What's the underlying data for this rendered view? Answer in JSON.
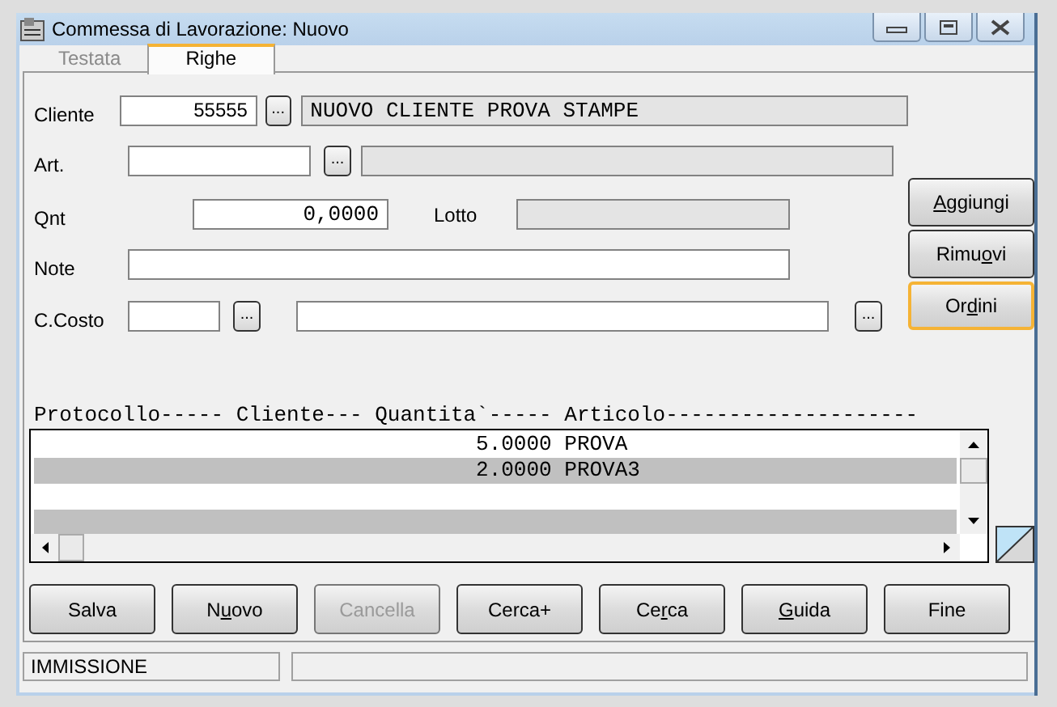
{
  "window": {
    "title": "Commessa di Lavorazione: Nuovo"
  },
  "tabs": [
    {
      "label": "Testata",
      "selected": false
    },
    {
      "label": "Righe",
      "selected": true
    }
  ],
  "form": {
    "cliente": {
      "label": "Cliente",
      "value": "55555",
      "description": "NUOVO CLIENTE PROVA STAMPE"
    },
    "articolo": {
      "label": "Art."
    },
    "quantita": {
      "label": "Qnt",
      "value": "0,0000"
    },
    "lotto": {
      "label": "Lotto"
    },
    "note": {
      "label": "Note"
    },
    "centro_costo": {
      "label": "C.Costo"
    },
    "browse_button": "..."
  },
  "side_buttons": [
    {
      "key": "A",
      "post": "ggiungi",
      "focused": false
    },
    {
      "pre": "Rimu",
      "key": "o",
      "post": "vi",
      "focused": false
    },
    {
      "pre": "Or",
      "key": "d",
      "post": "ini",
      "focused": true
    }
  ],
  "list": {
    "header": "Protocollo----- Cliente--- Quantita`----- Articolo--------------------",
    "rows": [
      {
        "quantita": "5.0000",
        "articolo": "PROVA"
      },
      {
        "quantita": "2.0000",
        "articolo": "PROVA3"
      }
    ]
  },
  "buttons": [
    {
      "pre": "Salva",
      "disabled": false
    },
    {
      "pre": "N",
      "key": "u",
      "post": "ovo",
      "disabled": false
    },
    {
      "pre": "Cancella",
      "disabled": true
    },
    {
      "pre": "Cerca+",
      "disabled": false
    },
    {
      "pre": "Ce",
      "key": "r",
      "post": "ca",
      "disabled": false
    },
    {
      "key": "G",
      "post": "uida",
      "disabled": false
    },
    {
      "pre": "Fine",
      "disabled": false
    }
  ],
  "status_bar": {
    "mode": "IMMISSIONE"
  }
}
